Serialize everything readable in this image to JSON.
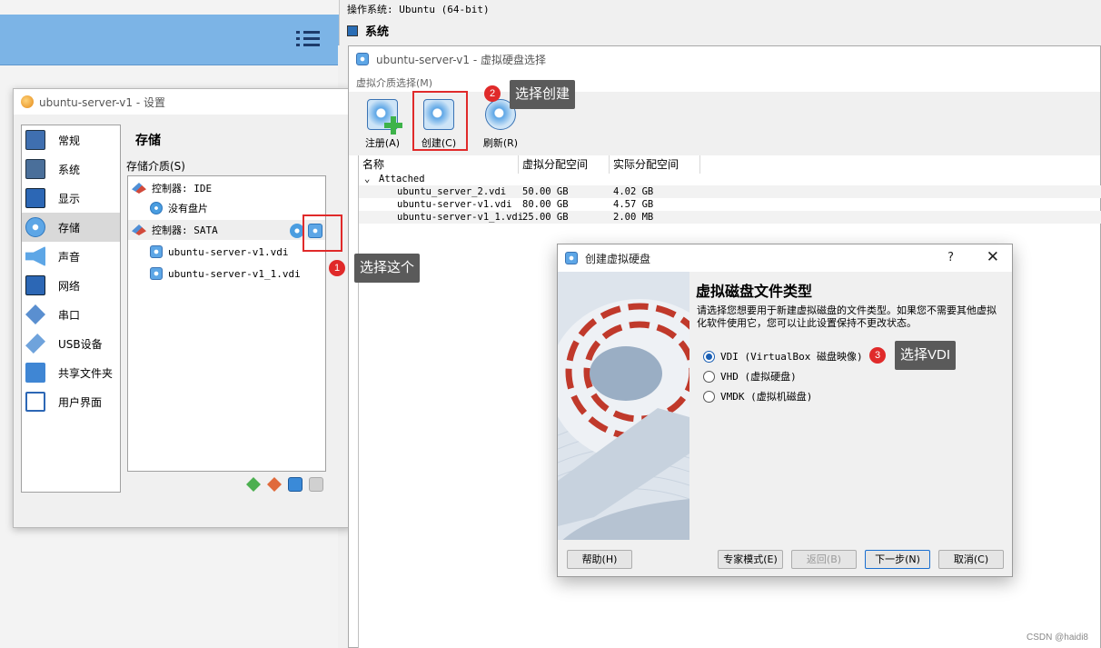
{
  "info": {
    "os_line": "操作系统:  Ubuntu (64-bit)",
    "system_header": "系统"
  },
  "settings": {
    "title": "ubuntu-server-v1 - 设置",
    "sidebar": [
      {
        "label": "常规",
        "icon": "general-icon"
      },
      {
        "label": "系统",
        "icon": "system-icon"
      },
      {
        "label": "显示",
        "icon": "display-icon"
      },
      {
        "label": "存储",
        "icon": "storage-icon",
        "selected": true
      },
      {
        "label": "声音",
        "icon": "audio-icon"
      },
      {
        "label": "网络",
        "icon": "network-icon"
      },
      {
        "label": "串口",
        "icon": "serial-port-icon"
      },
      {
        "label": "USB设备",
        "icon": "usb-icon"
      },
      {
        "label": "共享文件夹",
        "icon": "shared-folder-icon"
      },
      {
        "label": "用户界面",
        "icon": "user-interface-icon"
      }
    ],
    "page_title": "存储",
    "media_label": "存储介质(S)",
    "tree": {
      "ide_controller": "控制器: IDE",
      "empty_drive": "没有盘片",
      "sata_controller": "控制器: SATA",
      "disk1": "ubuntu-server-v1.vdi",
      "disk2": "ubuntu-server-v1_1.vdi"
    }
  },
  "selector": {
    "title": "ubuntu-server-v1 - 虚拟硬盘选择",
    "menu_label": "虚拟介质选择(M)",
    "toolbar": {
      "add": "注册(A)",
      "create": "创建(C)",
      "refresh": "刷新(R)"
    },
    "columns": [
      "名称",
      "虚拟分配空间",
      "实际分配空间"
    ],
    "group": "Attached",
    "rows": [
      {
        "name": "ubuntu_server_2.vdi",
        "virtual": "50.00 GB",
        "actual": "4.02 GB"
      },
      {
        "name": "ubuntu-server-v1.vdi",
        "virtual": "80.00 GB",
        "actual": "4.57 GB"
      },
      {
        "name": "ubuntu-server-v1_1.vdi",
        "virtual": "25.00 GB",
        "actual": "2.00 MB"
      }
    ]
  },
  "create_dialog": {
    "title": "创建虚拟硬盘",
    "help_glyph": "?",
    "close_glyph": "✕",
    "heading": "虚拟磁盘文件类型",
    "description": "请选择您想要用于新建虚拟磁盘的文件类型。如果您不需要其他虚拟化软件使用它，您可以让此设置保持不更改状态。",
    "options": [
      {
        "label": "VDI (VirtualBox 磁盘映像)",
        "selected": true
      },
      {
        "label": "VHD (虚拟硬盘)",
        "selected": false
      },
      {
        "label": "VMDK (虚拟机磁盘)",
        "selected": false
      }
    ],
    "buttons": {
      "help": "帮助(H)",
      "expert": "专家模式(E)",
      "back": "返回(B)",
      "next": "下一步(N)",
      "cancel": "取消(C)"
    }
  },
  "annotations": [
    {
      "num": "1",
      "text": "选择这个"
    },
    {
      "num": "2",
      "text": "选择创建"
    },
    {
      "num": "3",
      "text": "选择VDI"
    }
  ],
  "watermark": "CSDN @haidi8",
  "colors": {
    "accent": "#e02a2a",
    "callout_bg": "#5a5a5a",
    "manager_bar": "#7cb4e6"
  }
}
